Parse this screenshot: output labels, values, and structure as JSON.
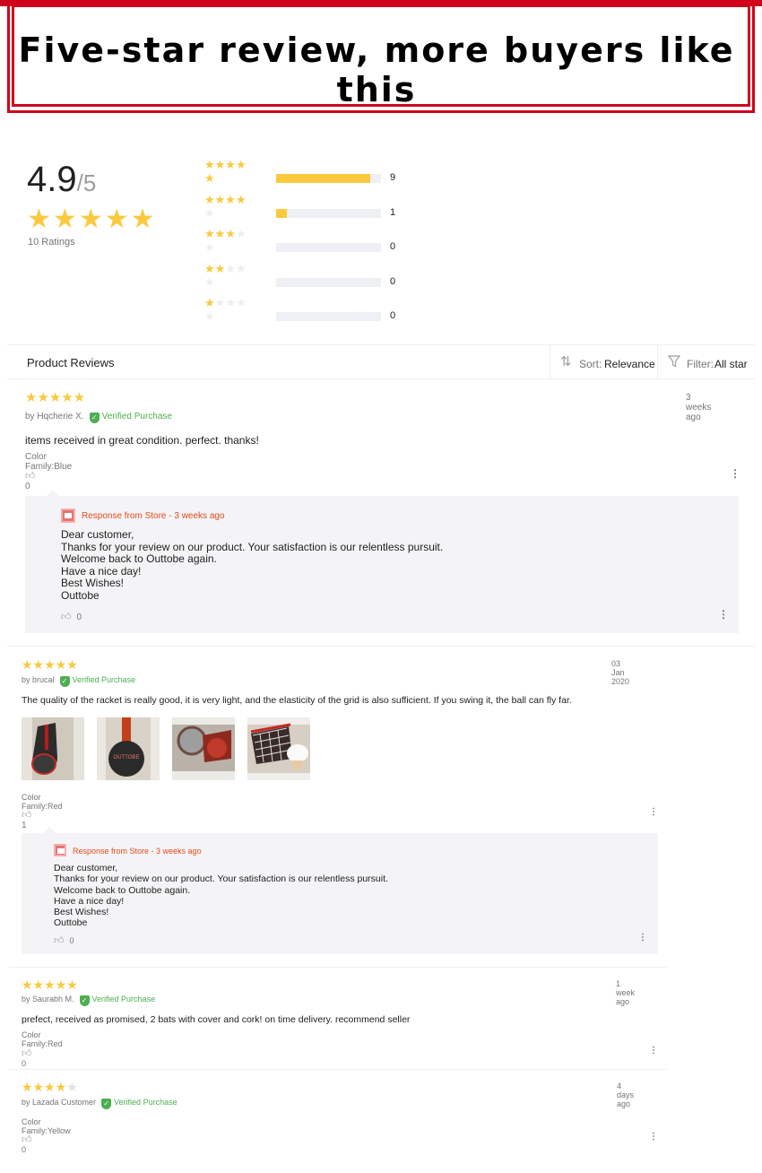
{
  "banner": {
    "title": "Five-star review, more buyers like this"
  },
  "summary": {
    "average": "4.9",
    "out_of": "/5",
    "ratings_count": "10 Ratings",
    "distribution": [
      {
        "stars": 5,
        "count": "9",
        "fraction": 0.9
      },
      {
        "stars": 4,
        "count": "1",
        "fraction": 0.1
      },
      {
        "stars": 3,
        "count": "0",
        "fraction": 0
      },
      {
        "stars": 2,
        "count": "0",
        "fraction": 0
      },
      {
        "stars": 1,
        "count": "0",
        "fraction": 0
      }
    ]
  },
  "reviews_header": {
    "title": "Product Reviews",
    "sort_label": "Sort:",
    "sort_value": "Relevance",
    "filter_label": "Filter:",
    "filter_value": "All star"
  },
  "reviews": [
    {
      "rating": 5,
      "date": "3 weeks ago",
      "by": "by Hqcherie X.",
      "verified": "Verified Purchase",
      "content": "items received in great condition. perfect. thanks!",
      "sku": "Color Family:Blue",
      "likes": "0",
      "response": {
        "title": "Response from Store - 3 weeks ago",
        "body": "Dear customer,\nThanks for your review on our product. Your satisfaction is our relentless pursuit.\nWelcome back to Outtobe again.\nHave a nice day!\nBest Wishes!\nOuttobe",
        "likes": "0"
      }
    },
    {
      "rating": 5,
      "date": "03 Jan 2020",
      "by": "by brucal",
      "verified": "Verified Purchase",
      "content": "The quality of the racket is really good, it is very light, and the elasticity of the grid is also sufficient. If you swing it, the ball can fly far.",
      "sku": "Color Family:Red",
      "likes": "1",
      "response": {
        "title": "Response from Store - 3 weeks ago",
        "body": "Dear customer,\nThanks for your review on our product. Your satisfaction is our relentless pursuit.\nWelcome back to Outtobe again.\nHave a nice day!\nBest Wishes!\nOuttobe",
        "likes": "0"
      }
    },
    {
      "rating": 5,
      "date": "1 week ago",
      "by": "by Saurabh M.",
      "verified": "Verified Purchase",
      "content": "prefect, received as promised, 2 bats with cover and cork! on time delivery. recommend seller",
      "sku": "Color Family:Red",
      "likes": "0"
    },
    {
      "rating": 4,
      "date": "4 days ago",
      "by": "by Lazada Customer",
      "verified": "Verified Purchase",
      "sku": "Color Family:Yellow",
      "likes": "0"
    }
  ],
  "icons": {
    "star": "star-icon",
    "sort": "sort-icon",
    "filter": "filter-icon",
    "thumb": "thumbs-up-icon",
    "more": "more-options-icon",
    "verified": "verified-shield-icon",
    "store": "store-icon"
  },
  "colors": {
    "accent_red": "#d0021b",
    "star_yellow": "#fac93e",
    "verified_green": "#4caf50",
    "response_orange": "#e64a19"
  }
}
